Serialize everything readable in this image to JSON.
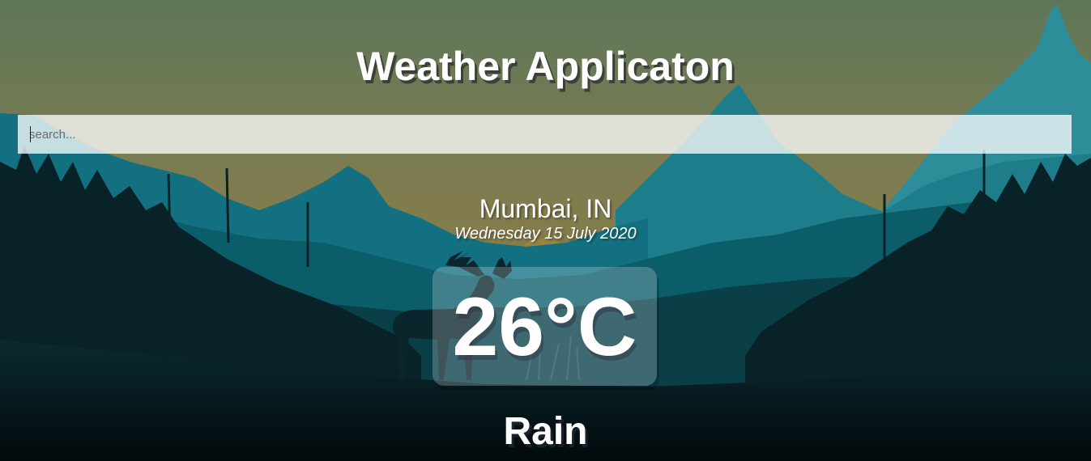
{
  "app": {
    "title": "Weather Applicaton"
  },
  "search": {
    "placeholder": "search...",
    "value": ""
  },
  "weather": {
    "location": "Mumbai, IN",
    "date": "Wednesday 15 July 2020",
    "temperature": "26°C",
    "condition": "Rain"
  },
  "colors": {
    "sky_top": "#5e7758",
    "sky_mid": "#887e4a",
    "mountain_far": "#2f8f9b",
    "mountain_mid": "#0e6978",
    "forest_dark": "#0c2a30",
    "ground": "#031418",
    "text": "#ffffff"
  },
  "icons": {
    "background": "mountain-landscape-with-deer"
  }
}
